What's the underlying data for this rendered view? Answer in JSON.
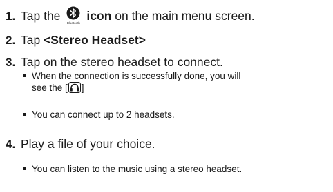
{
  "steps": [
    {
      "number": "1.",
      "before": "Tap the",
      "icon_name": "bluetooth-icon",
      "icon_caption": "Bluetooth",
      "bold": "icon",
      "after": " on the main menu screen."
    },
    {
      "number": "2.",
      "before": "Tap ",
      "bold": "<Stereo Headset>"
    },
    {
      "number": "3.",
      "text": "Tap on the stereo headset to connect.",
      "bullets": [
        {
          "line1": "When the connection is successfully done, you will",
          "line2_before": "see the [",
          "icon_name": "headset-connected-icon",
          "line2_after": "]"
        },
        {
          "text": "You can connect up to 2 headsets."
        }
      ]
    },
    {
      "number": "4.",
      "text": "Play a file of your choice.",
      "bullets": [
        {
          "text": "You can listen to the music using a stereo headset."
        }
      ]
    }
  ]
}
